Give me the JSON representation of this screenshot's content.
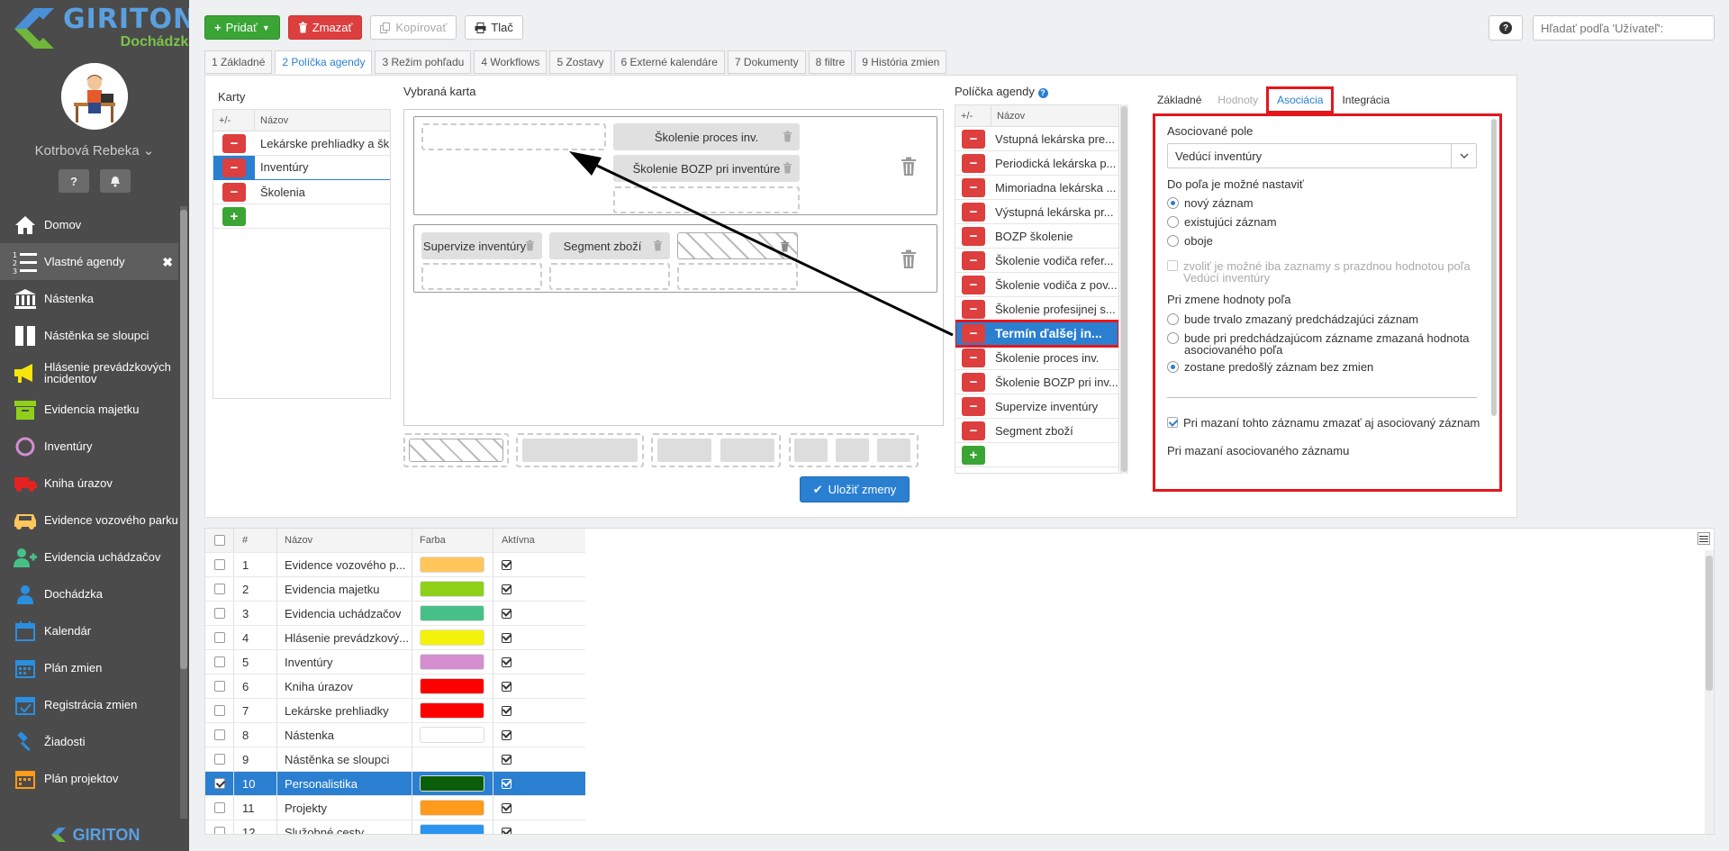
{
  "sidebar": {
    "brand": "GIRITON",
    "brand_sub": "Dochádzka",
    "user_name": "Kotrbová Rebeka",
    "help_label": "?",
    "items": [
      {
        "label": "Domov",
        "icon": "home-icon"
      },
      {
        "label": "Vlastné agendy",
        "icon": "list-numbered-icon",
        "active": true
      },
      {
        "label": "Nástenka",
        "icon": "bank-icon"
      },
      {
        "label": "Nástěnka se sloupci",
        "icon": "columns-icon"
      },
      {
        "label": "Hlásenie prevádzkových incidentov",
        "icon": "megaphone-icon"
      },
      {
        "label": "Evidencia majetku",
        "icon": "archive-box-icon"
      },
      {
        "label": "Inventúry",
        "icon": "circle-icon"
      },
      {
        "label": "Kniha úrazov",
        "icon": "ambulance-icon"
      },
      {
        "label": "Evidence vozového parku",
        "icon": "car-icon"
      },
      {
        "label": "Evidencia uchádzačov",
        "icon": "user-add-icon"
      },
      {
        "label": "Dochádzka",
        "icon": "user-icon"
      },
      {
        "label": "Kalendár",
        "icon": "calendar-icon"
      },
      {
        "label": "Plán zmien",
        "icon": "calendar-grid-icon"
      },
      {
        "label": "Registrácia zmien",
        "icon": "calendar-check-icon"
      },
      {
        "label": "Žiadosti",
        "icon": "gavel-icon"
      },
      {
        "label": "Plán projektov",
        "icon": "calendar-orange-icon"
      }
    ],
    "footer_brand": "GIRITON"
  },
  "toolbar": {
    "add_label": "Pridať",
    "delete_label": "Zmazať",
    "copy_label": "Kopírovať",
    "print_label": "Tlač"
  },
  "search": {
    "placeholder": "Hľadať podľa 'Užívateľ':",
    "help": "?"
  },
  "tabs": [
    "1 Základné",
    "2 Políčka agendy",
    "3 Režim pohľadu",
    "4 Workflows",
    "5 Zostavy",
    "6 Externé kalendáre",
    "7 Dokumenty",
    "8 filtre",
    "9 História zmien"
  ],
  "karty": {
    "title": "Karty",
    "col_pm": "+/-",
    "col_name": "Názov",
    "rows": [
      "Lekárske prehliadky a šk",
      "Inventúry",
      "Školenia"
    ]
  },
  "vybrana": {
    "title": "Vybraná karta",
    "row1_chips": [
      "Školenie proces inv.",
      "Školenie BOZP pri inventúre"
    ],
    "row2_chips": [
      "Supervize inventúry",
      "Segment zboží"
    ]
  },
  "policka": {
    "title": "Políčka agendy",
    "col_pm": "+/-",
    "col_name": "Názov",
    "rows": [
      "Vstupná lekárska pre...",
      "Periodická lekárska p...",
      "Mimoriadna lekárska ...",
      "Výstupná lekárska pr...",
      "BOZP školenie",
      "Školenie vodiča refer...",
      "Školenie vodiča z pov...",
      "Školenie profesijnej s...",
      "Termín ďalšej in...",
      "Školenie proces inv.",
      "Školenie BOZP pri inv...",
      "Supervize inventúry",
      "Segment zboží"
    ]
  },
  "save_label": "Uložiť zmeny",
  "right_tabs": [
    "Základné",
    "Hodnoty",
    "Asociácia",
    "Integrácia"
  ],
  "assoc": {
    "field_label": "Asociované pole",
    "field_value": "Vedúcí inventúry",
    "can_set_label": "Do poľa je možné nastaviť",
    "opt1": "nový záznam",
    "opt2": "existujúci záznam",
    "opt3": "oboje",
    "empty_only": "zvoliť je možné iba zaznamy s prazdnou hodnotou poľa Vedúcí inventúry",
    "on_change_label": "Pri zmene hodnoty poľa",
    "chg1": "bude trvalo zmazaný predchádzajúci záznam",
    "chg2": "bude pri predchádzajúcom zázname zmazaná hodnota asociovaného poľa",
    "chg3": "zostane predošlý záznam bez zmien",
    "delete_assoc": "Pri mazaní tohto záznamu zmazať aj asociovaný záznam",
    "on_assoc_delete": "Pri mazaní asociovaného záznamu"
  },
  "grid": {
    "headers": [
      "#",
      "Názov",
      "Farba",
      "Aktívna"
    ],
    "rows": [
      {
        "n": "1",
        "name": "Evidence vozového p...",
        "color": "#ffc65c"
      },
      {
        "n": "2",
        "name": "Evidencia majetku",
        "color": "#8fd11a"
      },
      {
        "n": "3",
        "name": "Evidencia uchádzačov",
        "color": "#47c088"
      },
      {
        "n": "4",
        "name": "Hlásenie prevádzkový...",
        "color": "#f2f20a"
      },
      {
        "n": "5",
        "name": "Inventúry",
        "color": "#d48ed0"
      },
      {
        "n": "6",
        "name": "Kniha úrazov",
        "color": "#ff0000"
      },
      {
        "n": "7",
        "name": "Lekárske prehliadky",
        "color": "#ff0000"
      },
      {
        "n": "8",
        "name": "Nástenka",
        "color": "#ffffff"
      },
      {
        "n": "9",
        "name": "Nástěnka se sloupci",
        "color": ""
      },
      {
        "n": "10",
        "name": "Personalistika",
        "color": "#0a5e0a",
        "selected": true
      },
      {
        "n": "11",
        "name": "Projekty",
        "color": "#ff9a1a"
      },
      {
        "n": "12",
        "name": "Služobné cesty",
        "color": "#2a95f0"
      }
    ]
  }
}
